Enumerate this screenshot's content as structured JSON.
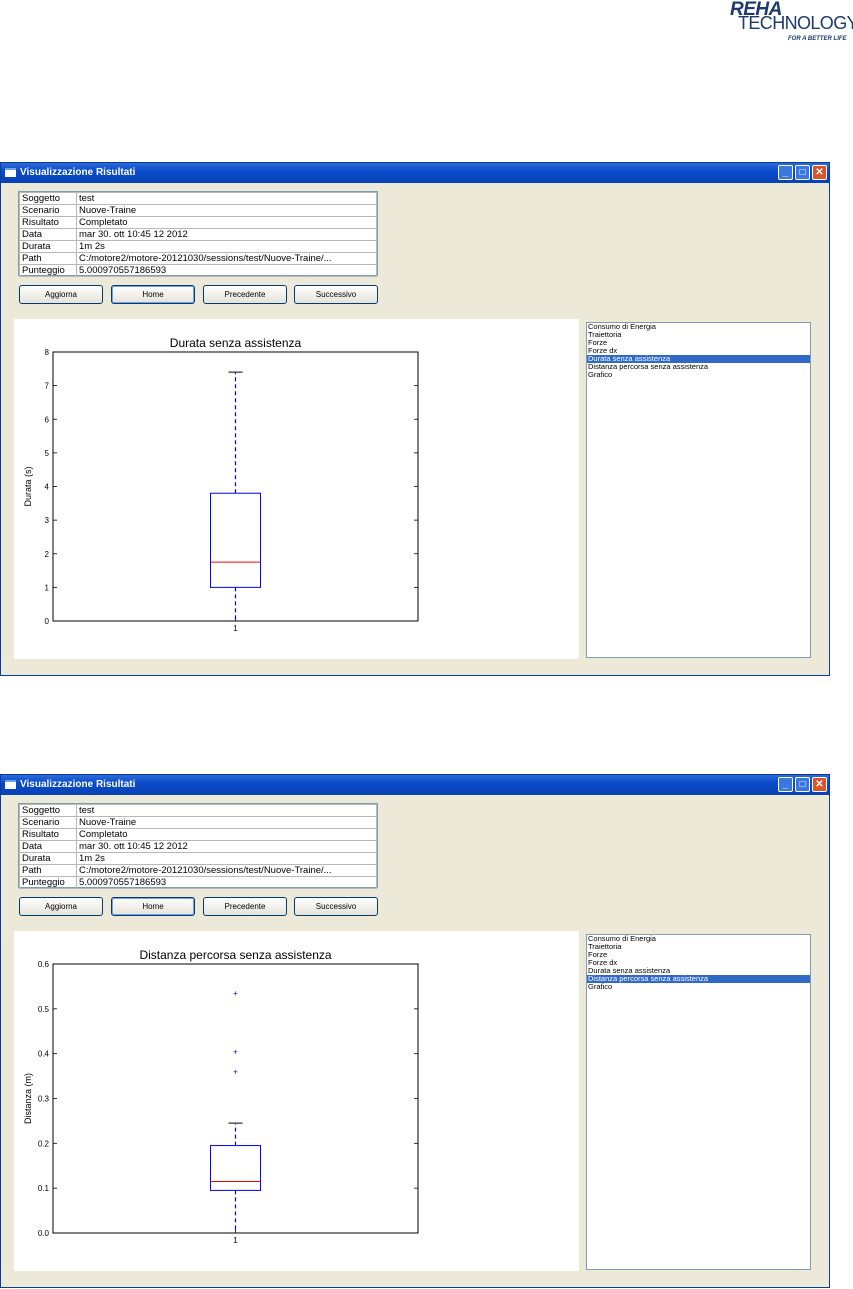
{
  "logo": {
    "brand": "REHA",
    "sub": "TECHNOLOGY",
    "tagline": "FOR A BETTER LIFE"
  },
  "windows": [
    {
      "title": "Visualizzazione Risultati",
      "info_rows": [
        {
          "key": "Soggetto",
          "value": "test"
        },
        {
          "key": "Scenario",
          "value": "Nuove-Traine"
        },
        {
          "key": "Risultato",
          "value": "Completato"
        },
        {
          "key": "Data",
          "value": "mar 30. ott 10:45 12 2012"
        },
        {
          "key": "Durata",
          "value": "1m 2s"
        },
        {
          "key": "Path",
          "value": "C:/motore2/motore-20121030/sessions/test/Nuove-Traine/..."
        },
        {
          "key": "Punteggio",
          "value": "5.000970557186593"
        }
      ],
      "buttons": {
        "refresh": "Aggiorna",
        "close": "Home",
        "previous": "Precedente",
        "next": "Successivo"
      },
      "list_items": [
        "Consumo di Energia",
        "Traiettoria",
        "Forze",
        "Forze dx",
        "Durata senza assistenza",
        "Distanza percorsa senza assistenza",
        "Grafico"
      ],
      "selected_index": 4,
      "chart_data": {
        "type": "box",
        "title": "Durata senza assistenza",
        "ylabel": "Durata (s)",
        "xlabel": "",
        "categories": [
          "1"
        ],
        "ylim": [
          0,
          8
        ],
        "yticks": [
          0,
          1,
          2,
          3,
          4,
          5,
          6,
          7,
          8
        ],
        "box": {
          "whisker_low": 0,
          "q1": 1.0,
          "median": 1.75,
          "q3": 3.8,
          "whisker_high": 7.4
        },
        "outliers": []
      }
    },
    {
      "title": "Visualizzazione Risultati",
      "info_rows": [
        {
          "key": "Soggetto",
          "value": "test"
        },
        {
          "key": "Scenario",
          "value": "Nuove-Traine"
        },
        {
          "key": "Risultato",
          "value": "Completato"
        },
        {
          "key": "Data",
          "value": "mar 30. ott 10:45 12 2012"
        },
        {
          "key": "Durata",
          "value": "1m 2s"
        },
        {
          "key": "Path",
          "value": "C:/motore2/motore-20121030/sessions/test/Nuove-Traine/..."
        },
        {
          "key": "Punteggio",
          "value": "5.000970557186593"
        }
      ],
      "buttons": {
        "refresh": "Aggiorna",
        "close": "Home",
        "previous": "Precedente",
        "next": "Successivo"
      },
      "list_items": [
        "Consumo di Energia",
        "Traiettoria",
        "Forze",
        "Forze dx",
        "Durata senza assistenza",
        "Distanza percorsa senza assistenza",
        "Grafico"
      ],
      "selected_index": 5,
      "chart_data": {
        "type": "box",
        "title": "Distanza percorsa senza assistenza",
        "ylabel": "Distanza (m)",
        "xlabel": "",
        "categories": [
          "1"
        ],
        "ylim": [
          0,
          0.6
        ],
        "yticks": [
          "0.0",
          "0.1",
          "0.2",
          "0.3",
          "0.4",
          "0.5",
          "0.6"
        ],
        "box": {
          "whisker_low": 0,
          "q1": 0.095,
          "median": 0.115,
          "q3": 0.195,
          "whisker_high": 0.245
        },
        "outliers": [
          0.36,
          0.405,
          0.535
        ]
      }
    }
  ],
  "colors": {
    "titlebar": "#0a4bc9",
    "box": "#0000ff",
    "median": "#ff0000",
    "selection": "#316ac5"
  }
}
